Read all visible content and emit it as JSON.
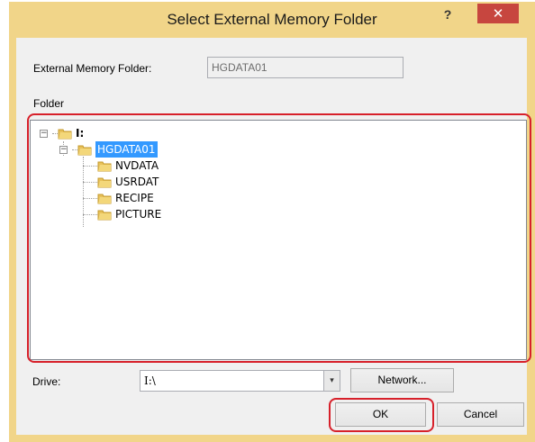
{
  "dialog": {
    "title": "Select External Memory Folder",
    "help_glyph": "?",
    "close_glyph": "✕"
  },
  "external_memory_folder": {
    "label": "External Memory Folder:",
    "value": "HGDATA01"
  },
  "folder_section": {
    "label": "Folder"
  },
  "tree": {
    "root": "I:",
    "selected": "HGDATA01",
    "children": [
      "NVDATA",
      "USRDAT",
      "RECIPE",
      "PICTURE"
    ],
    "collapse_glyph": "−"
  },
  "drive": {
    "label": "Drive:",
    "value": "I:\\",
    "arrow_glyph": "▾"
  },
  "buttons": {
    "network": "Network...",
    "ok": "OK",
    "cancel": "Cancel"
  },
  "colors": {
    "highlight_outline": "#d7202a",
    "selection": "#3399ff",
    "title_frame": "#f1d589",
    "close_button": "#c7463f"
  }
}
